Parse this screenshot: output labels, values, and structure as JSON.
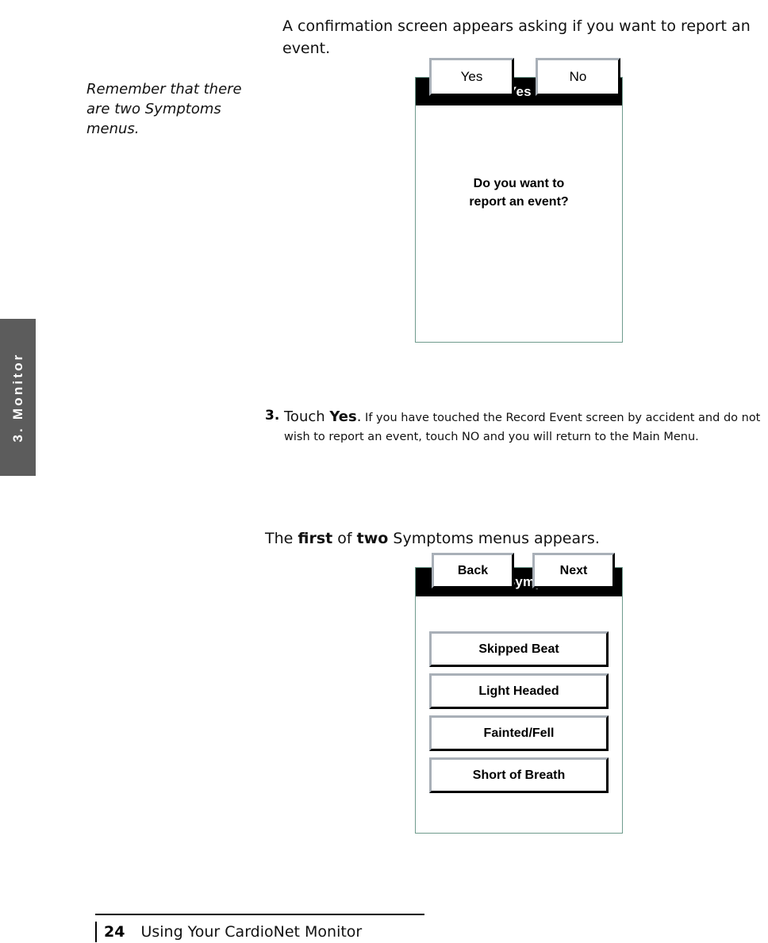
{
  "chapter_tab": {
    "label": "3.  Monitor"
  },
  "intro": {
    "paragraph": "A confirmation screen appears asking if you want to report an event."
  },
  "margin_note": {
    "text": "Remember that there are two Symptoms menus."
  },
  "step": {
    "number": "3.",
    "lead_prefix": "Touch ",
    "lead_bold": "Yes",
    "lead_suffix": ".",
    "detail": " If you have touched the Record Event screen by accident and do not wish to report an event, touch NO and you will return to the Main Menu."
  },
  "menus_line": {
    "part1": "The ",
    "bold1": "first",
    "part2": " of ",
    "bold2": "two",
    "part3": " Symptoms menus appears."
  },
  "screens": {
    "confirm": {
      "title": "Press Yes or No",
      "message_line1": "Do you want to",
      "message_line2": "report an event?",
      "buttons": [
        {
          "label": "Yes",
          "name": "yes-button"
        },
        {
          "label": "No",
          "name": "no-button"
        }
      ]
    },
    "symptoms": {
      "title": "Select Symptoms",
      "options": [
        {
          "label": "Skipped Beat"
        },
        {
          "label": "Light Headed"
        },
        {
          "label": "Fainted/Fell"
        },
        {
          "label": "Short of Breath"
        }
      ],
      "nav": [
        {
          "label": "Back",
          "name": "back-button"
        },
        {
          "label": "Next",
          "name": "next-button"
        }
      ]
    }
  },
  "footer": {
    "page_number": "24",
    "title": "Using Your CardioNet Monitor"
  },
  "colors": {
    "chapter_tab_bg": "#5c5c5c",
    "screen_border": "#6f9b8d",
    "titlebar_bg": "#000000",
    "bevel_light": "#a9b0b8",
    "bevel_dark": "#000000"
  }
}
